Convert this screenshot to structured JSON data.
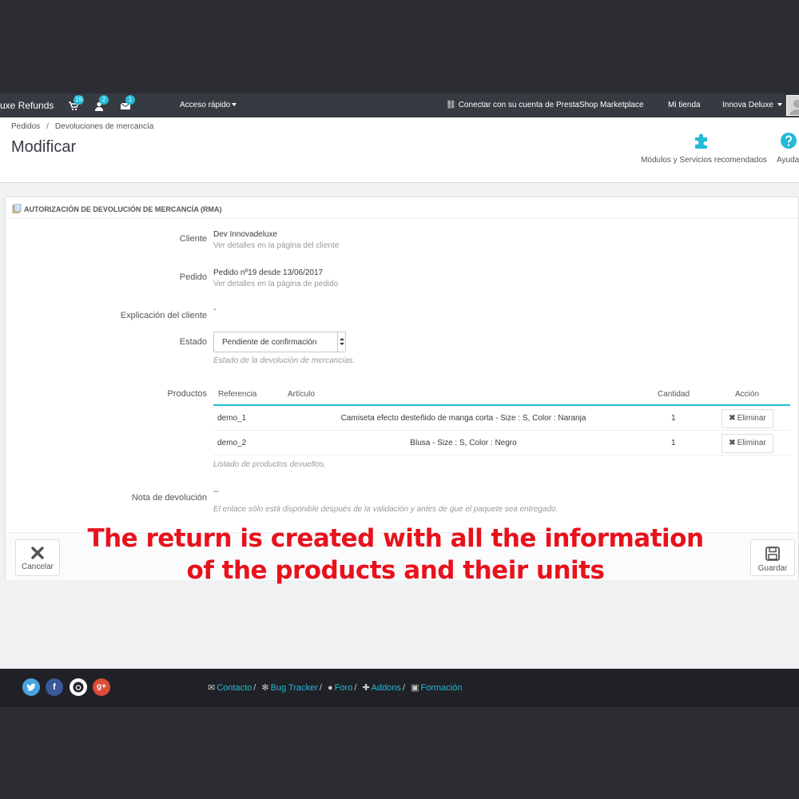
{
  "navbar": {
    "brand": "uxe Refunds",
    "badges": {
      "orders": "19",
      "customers": "2",
      "messages": "1"
    },
    "quick_access": "Acceso rápido",
    "marketplace": "Conectar con su cuenta de PrestaShop Marketplace",
    "my_store": "Mi tienda",
    "user": "Innova Deluxe"
  },
  "header": {
    "breadcrumb": [
      "Pedidos",
      "Devoluciones de mercancía"
    ],
    "breadcrumb_sep": "/",
    "title": "Modificar",
    "toolbar": {
      "modules_label": "Módulos y Servicios recomendados",
      "help_label": "Ayuda"
    }
  },
  "panel": {
    "heading": "Autorización de devolución de mercancía (RMA)",
    "customer": {
      "label": "Cliente",
      "value": "Dev Innovadeluxe",
      "link": "Ver detalles en la página del cliente"
    },
    "order": {
      "label": "Pedido",
      "value": "Pedido nº19 desde 13/06/2017",
      "link": "Ver detalles en la página de pedido"
    },
    "explanation": {
      "label": "Explicación del cliente",
      "value": "-"
    },
    "status": {
      "label": "Estado",
      "selected": "Pendiente de confirmación",
      "help": "Estado de la devolución de mercancías."
    },
    "products": {
      "label": "Productos",
      "columns": [
        "Referencia",
        "Artículo",
        "Cantidad",
        "Acción"
      ],
      "rows": [
        {
          "ref": "demo_1",
          "name": "Camiseta efecto desteñido de manga corta - Size : S, Color : Naranja",
          "qty": "1",
          "action": "Eliminar"
        },
        {
          "ref": "demo_2",
          "name": "Blusa - Size : S, Color : Negro",
          "qty": "1",
          "action": "Eliminar"
        }
      ],
      "help": "Listado de productos devueltos."
    },
    "return_note": {
      "label": "Nota de devolución",
      "value": "--",
      "help": "El enlace sólo está disponible después de la validación y antes de que el paquete sea entregado."
    },
    "cancel_label": "Cancelar",
    "save_label": "Guardar"
  },
  "overlay": {
    "line1": "The return is created with all the information",
    "line2": "of the products and their units",
    "color": "#e8121c"
  },
  "footer": {
    "links": [
      "Contacto",
      "Bug Tracker",
      "Foro",
      "Addons",
      "Formación"
    ],
    "social": [
      {
        "name": "twitter",
        "color": "#4aa3df"
      },
      {
        "name": "facebook",
        "color": "#3b5998"
      },
      {
        "name": "github",
        "color": "#ffffff"
      },
      {
        "name": "google-plus",
        "color": "#dd4b39"
      }
    ]
  },
  "colors": {
    "accent": "#25b9d7",
    "navbar": "#363a41",
    "footer": "#1f2126"
  }
}
